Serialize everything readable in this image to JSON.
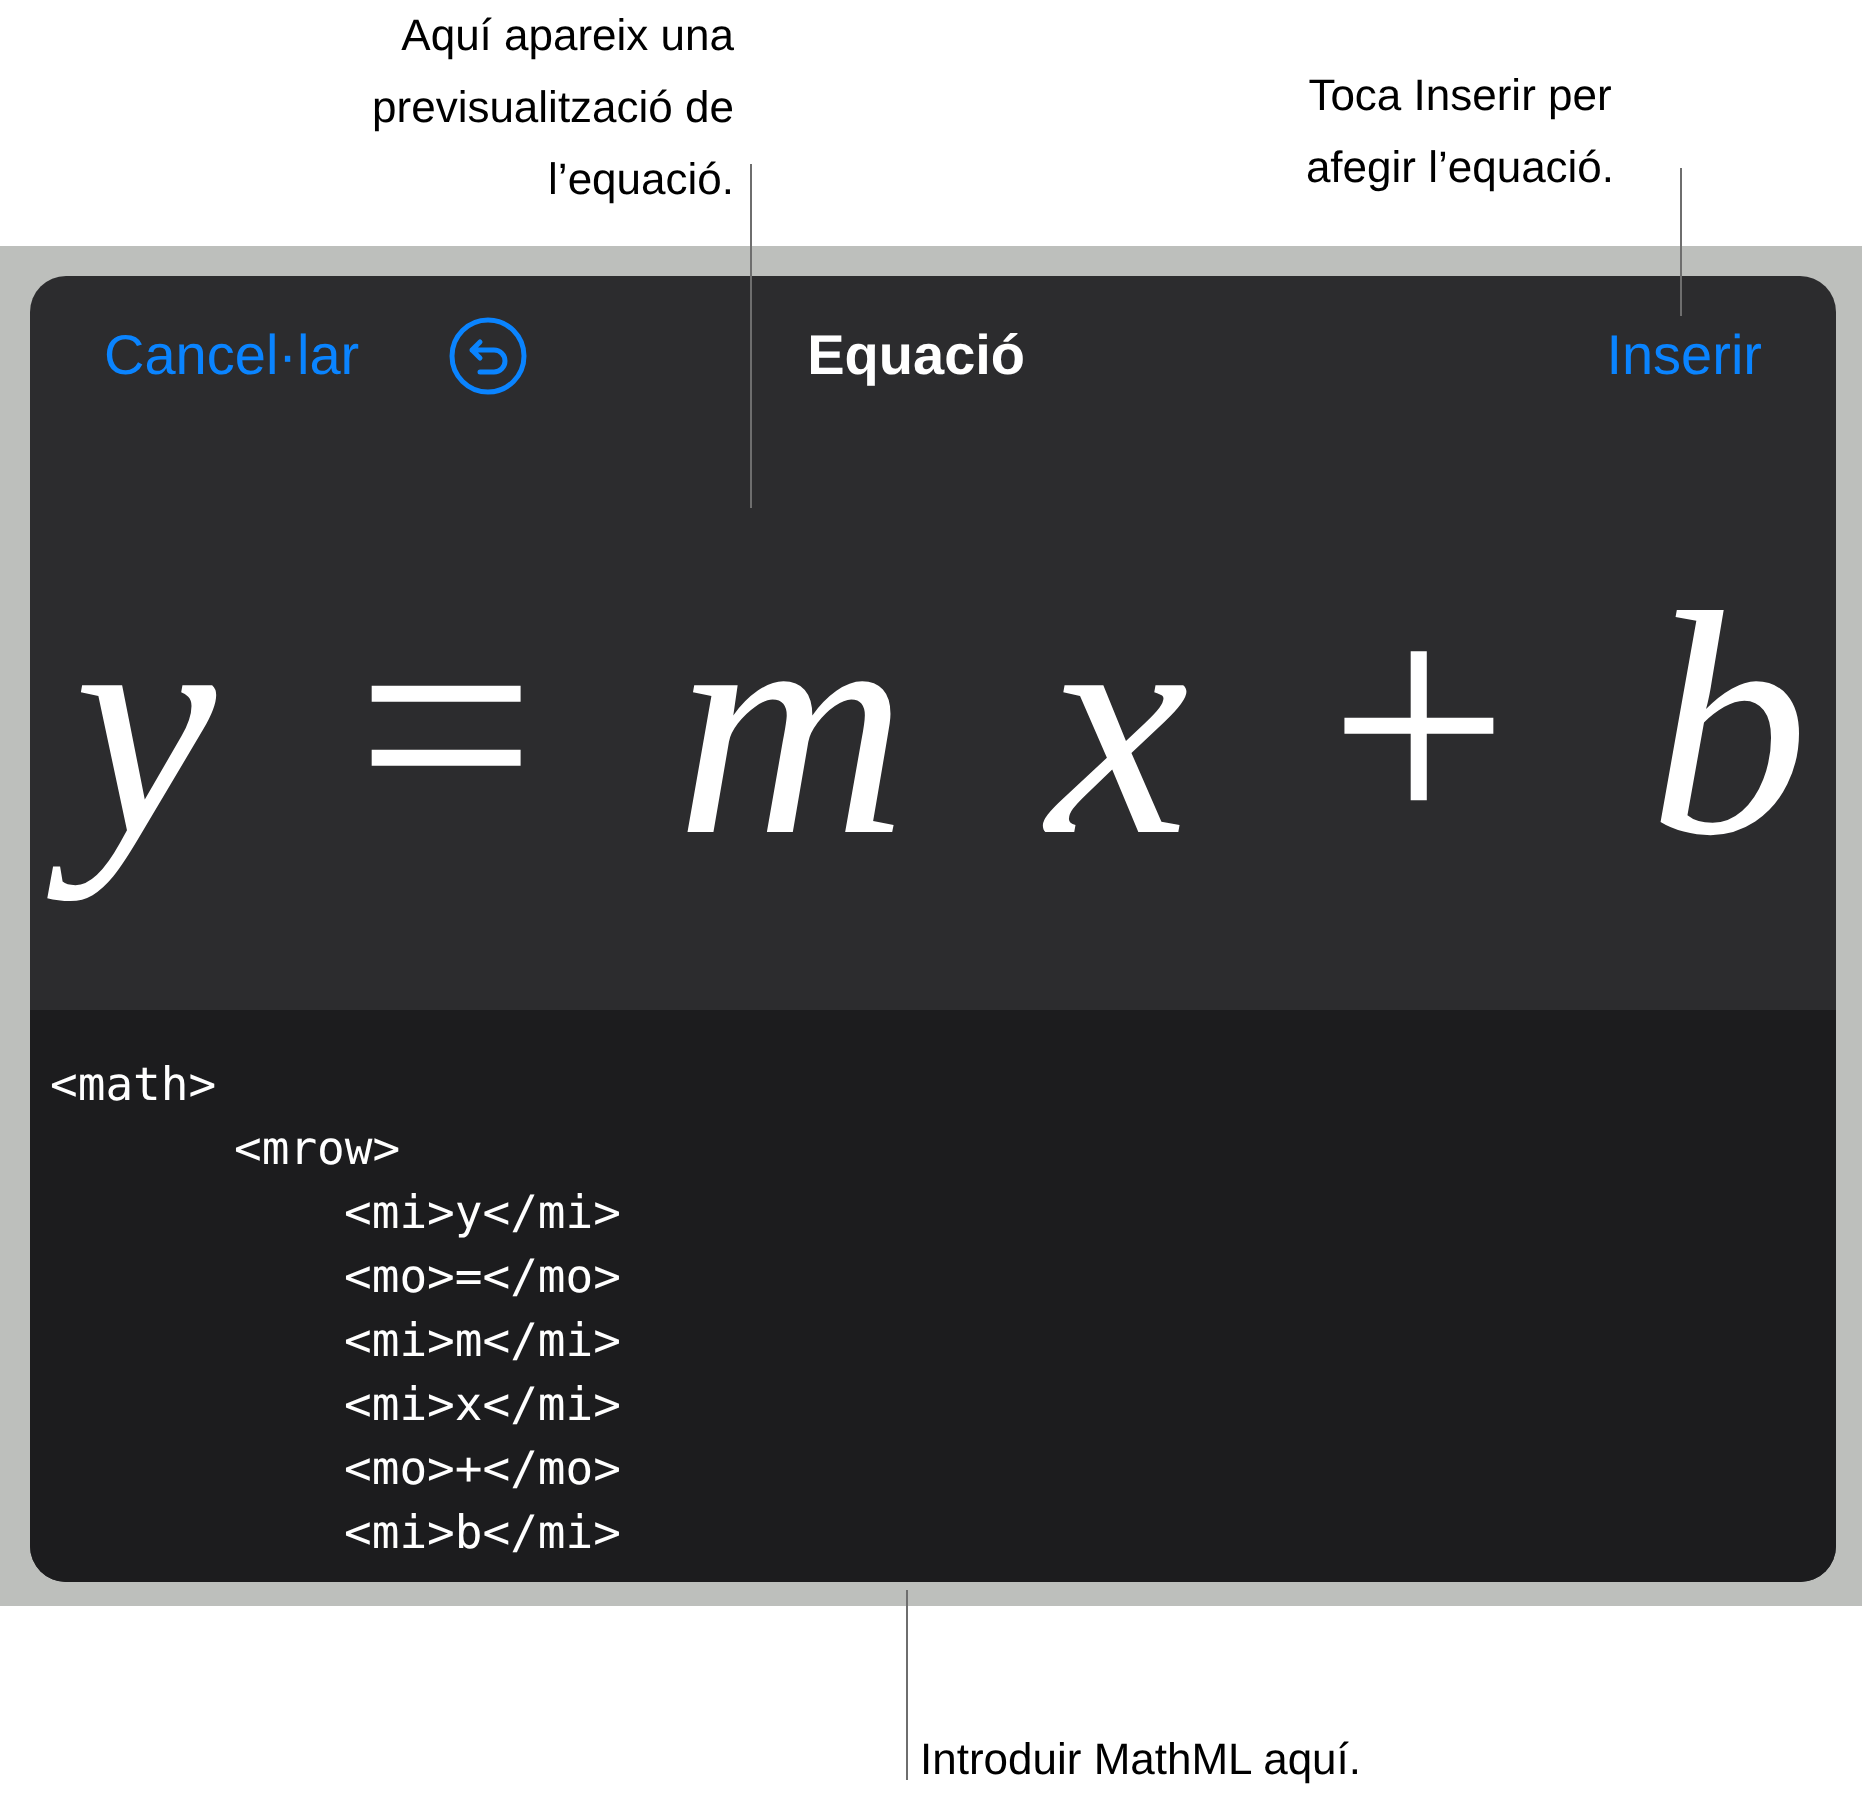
{
  "callouts": [
    {
      "kind": "preview",
      "text": "Aquí apareix una previsualització de l’equació."
    },
    {
      "kind": "insert",
      "text": "Toca Inserir per afegir l’equació."
    },
    {
      "kind": "code",
      "text": "Introduir MathML aquí."
    }
  ],
  "toolbar": {
    "cancel": "Cancel·lar",
    "title": "Equació",
    "insert": "Inserir"
  },
  "preview": {
    "tokens": [
      {
        "text": "y",
        "kind": "identifier"
      },
      {
        "text": "=",
        "kind": "operator"
      },
      {
        "text": "m",
        "kind": "identifier"
      },
      {
        "text": "x",
        "kind": "identifier"
      },
      {
        "text": "+",
        "kind": "operator"
      },
      {
        "text": "b",
        "kind": "identifier"
      }
    ]
  },
  "code": [
    {
      "text": "<math>",
      "children": [
        {
          "text": "<mrow>",
          "children": [
            {
              "text": "<mi>y</mi>"
            },
            {
              "text": "<mo>=</mo>"
            },
            {
              "text": "<mi>m</mi>"
            },
            {
              "text": "<mi>x</mi>"
            },
            {
              "text": "<mo>+</mo>"
            },
            {
              "text": "<mi>b</mi>"
            }
          ]
        }
      ]
    }
  ]
}
